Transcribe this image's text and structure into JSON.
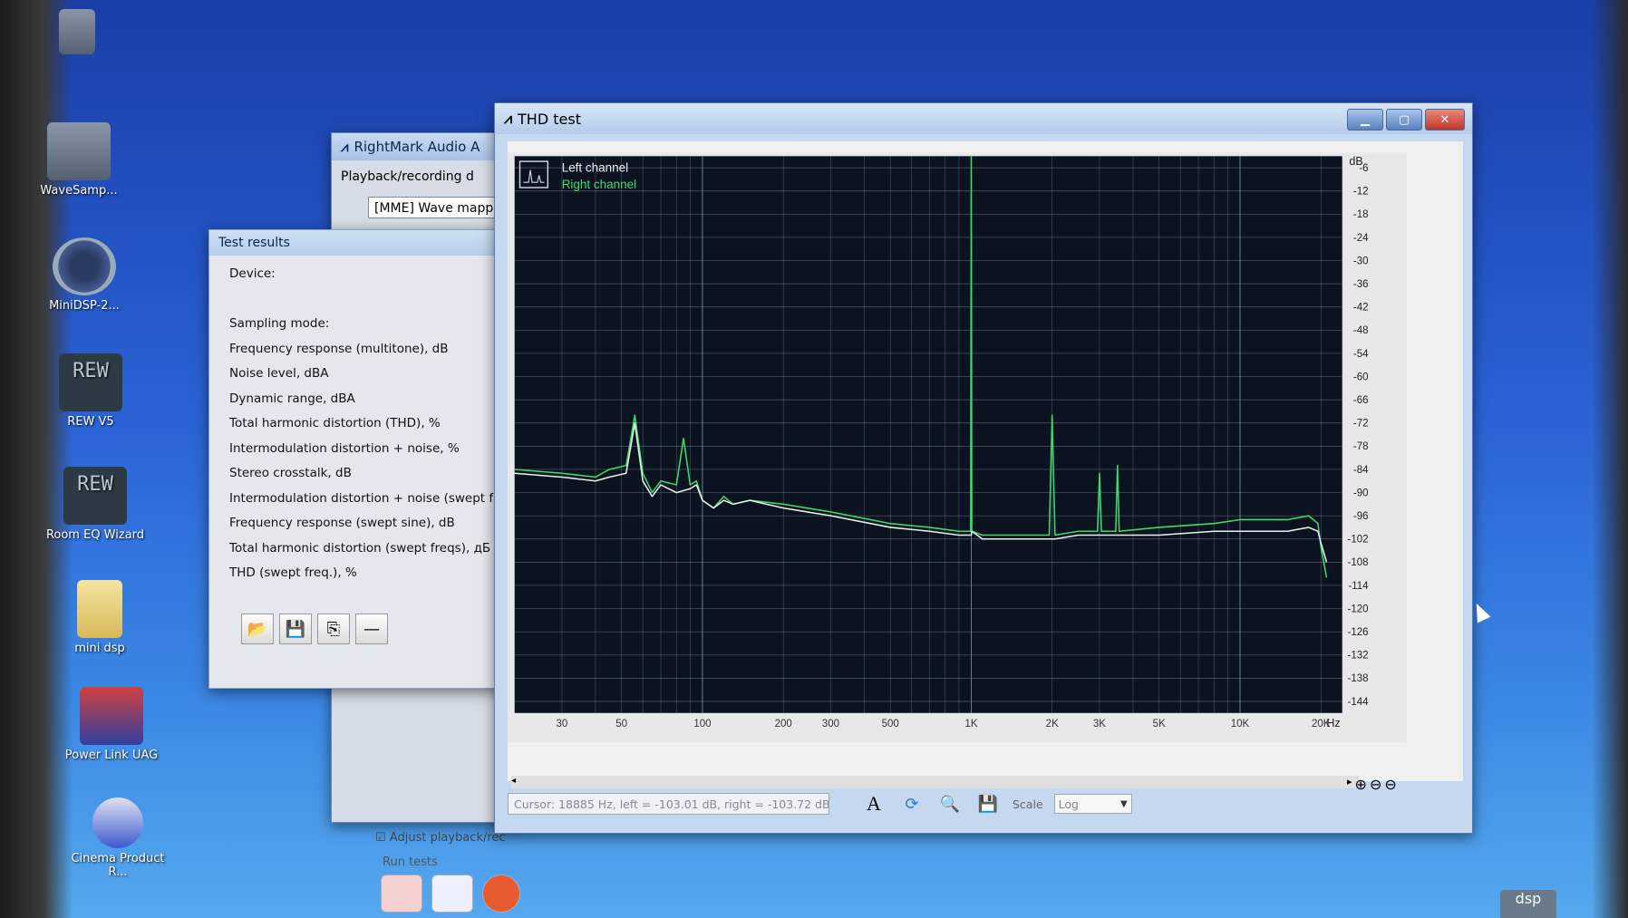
{
  "desktop": {
    "icons": [
      {
        "label": "",
        "icon": "recycle-bin-icon"
      },
      {
        "label": "WaveSamp...",
        "icon": "wave-app-icon"
      },
      {
        "label": "MiniDSP-2...",
        "icon": "minidsp-icon"
      },
      {
        "label": "REW V5",
        "icon": "rew-icon"
      },
      {
        "label": "Room EQ Wizard",
        "icon": "rew-wizard-icon"
      },
      {
        "label": "mini dsp",
        "icon": "folder-icon"
      },
      {
        "label": "Power Link UAG",
        "icon": "power-link-icon"
      },
      {
        "label": "Cinema Product R...",
        "icon": "cinema-icon"
      }
    ]
  },
  "rightmark": {
    "title": "RightMark Audio A",
    "group_label": "Playback/recording d",
    "device_value": "[MME] Wave mappe",
    "adjust_label": "Adjust playback/rec",
    "run_tests_label": "Run tests"
  },
  "results": {
    "title": "Test results",
    "items": [
      "Device:",
      "",
      "Sampling mode:",
      "Frequency response (multitone), dB",
      "Noise level, dBA",
      "Dynamic range, dBA",
      "Total harmonic distortion (THD), %",
      "Intermodulation distortion + noise, %",
      "Stereo crosstalk, dB",
      "Intermodulation distortion + noise (swept freqs)",
      "Frequency response (swept sine), dB",
      "Total harmonic distortion (swept freqs), дБ",
      "THD (swept freq.), %"
    ]
  },
  "thd": {
    "title": "THD test",
    "legend_left": "Left channel",
    "legend_right": "Right channel",
    "cursor_text": "Cursor: 18885 Hz, left = -103.01 dB, right = -103.72 dB",
    "scale_label": "Scale",
    "scale_value": "Log",
    "colors": {
      "background": "#0b1220",
      "grid": "#7f8fa0",
      "left": "#e6f2ea",
      "right": "#3cdc6c"
    }
  },
  "chart_data": {
    "type": "line",
    "x_scale": "log",
    "xlabel": "Hz",
    "ylabel": "dB",
    "xlim": [
      20,
      24000
    ],
    "ylim": [
      -147,
      -3
    ],
    "x_ticks": [
      {
        "v": 30,
        "t": "30"
      },
      {
        "v": 50,
        "t": "50"
      },
      {
        "v": 100,
        "t": "100"
      },
      {
        "v": 200,
        "t": "200"
      },
      {
        "v": 300,
        "t": "300"
      },
      {
        "v": 500,
        "t": "500"
      },
      {
        "v": 1000,
        "t": "1K"
      },
      {
        "v": 2000,
        "t": "2K"
      },
      {
        "v": 3000,
        "t": "3K"
      },
      {
        "v": 5000,
        "t": "5K"
      },
      {
        "v": 10000,
        "t": "10K"
      },
      {
        "v": 20000,
        "t": "20K"
      }
    ],
    "y_ticks": [
      -6,
      -12,
      -18,
      -24,
      -30,
      -36,
      -42,
      -48,
      -54,
      -60,
      -66,
      -72,
      -78,
      -84,
      -90,
      -96,
      -102,
      -108,
      -114,
      -120,
      -126,
      -132,
      -138,
      -144
    ],
    "grid": true,
    "legend": "top-left",
    "series": [
      {
        "name": "Left channel",
        "x": [
          20,
          30,
          40,
          45,
          52,
          56,
          60,
          65,
          70,
          80,
          90,
          95,
          100,
          110,
          120,
          130,
          150,
          200,
          300,
          500,
          700,
          900,
          1000,
          1005,
          1100,
          1500,
          1900,
          2000,
          2050,
          2500,
          3000,
          5000,
          8000,
          10000,
          15000,
          18000,
          19500,
          20000,
          21000
        ],
        "y": [
          -85,
          -86,
          -87,
          -86,
          -85,
          -72,
          -87,
          -91,
          -88,
          -90,
          -89,
          -88,
          -92,
          -94,
          -92,
          -93,
          -92,
          -94,
          -96,
          -99,
          -100,
          -101,
          -101,
          -100,
          -102,
          -102,
          -102,
          -102,
          -102,
          -101,
          -101,
          -101,
          -100,
          -100,
          -100,
          -99,
          -100,
          -103,
          -108
        ]
      },
      {
        "name": "Right channel",
        "x": [
          20,
          30,
          40,
          45,
          52,
          56,
          60,
          65,
          70,
          80,
          85,
          90,
          95,
          100,
          110,
          120,
          130,
          150,
          200,
          300,
          500,
          700,
          900,
          995,
          1000,
          1005,
          1100,
          1500,
          1950,
          2000,
          2050,
          2500,
          2950,
          3000,
          3050,
          3450,
          3500,
          3550,
          5000,
          8000,
          10000,
          15000,
          18000,
          19500,
          20000,
          21000
        ],
        "y": [
          -84,
          -85,
          -86,
          -84,
          -83,
          -70,
          -85,
          -90,
          -87,
          -88,
          -76,
          -88,
          -87,
          -92,
          -94,
          -91,
          -93,
          -92,
          -93,
          -95,
          -98,
          -99,
          -100,
          -100,
          -3,
          -100,
          -101,
          -101,
          -101,
          -70,
          -101,
          -100,
          -100,
          -85,
          -100,
          -100,
          -83,
          -100,
          -99,
          -98,
          -97,
          -97,
          -96,
          -98,
          -104,
          -112
        ]
      }
    ]
  }
}
